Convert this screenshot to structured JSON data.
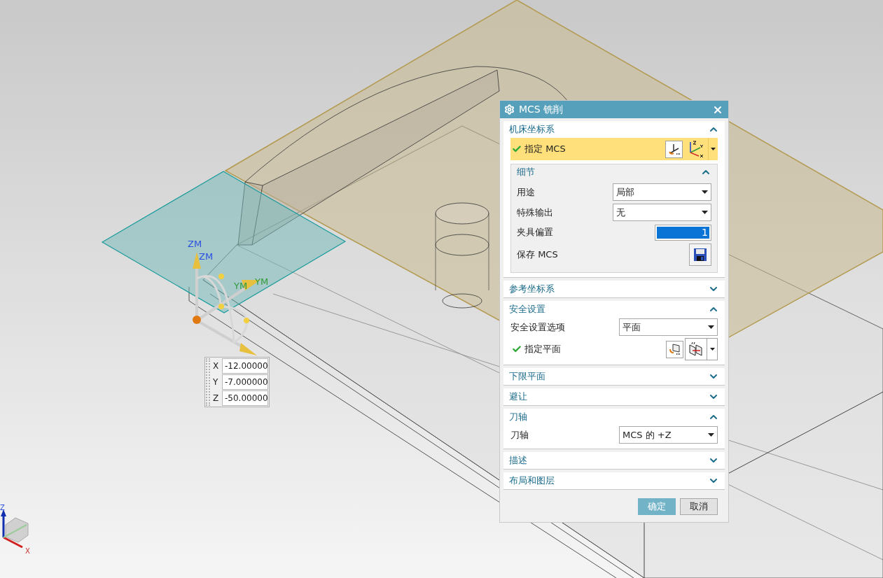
{
  "viewport": {
    "manipulator_labels": [
      "ZM",
      "ZM",
      "YM",
      "YM"
    ],
    "coord_fields": [
      {
        "label": "X",
        "value": "-12.00000"
      },
      {
        "label": "Y",
        "value": "-7.000000"
      },
      {
        "label": "Z",
        "value": "-50.00000"
      }
    ],
    "triad_labels": [
      "Z",
      "X"
    ]
  },
  "dialog": {
    "title": "MCS 铣削",
    "sections": [
      {
        "title": "机床坐标系",
        "expanded": true,
        "rows": [
          {
            "kind": "csys_selector",
            "label": "指定 MCS",
            "done": true,
            "highlighted": true
          },
          {
            "kind": "group",
            "title": "细节",
            "expanded": true,
            "rows": [
              {
                "kind": "dropdown",
                "label": "用途",
                "value": "局部"
              },
              {
                "kind": "dropdown",
                "label": "特殊输出",
                "value": "无"
              },
              {
                "kind": "number",
                "label": "夹具偏置",
                "value": "1",
                "selected": true
              },
              {
                "kind": "save",
                "label": "保存 MCS"
              }
            ]
          }
        ]
      },
      {
        "title": "参考坐标系",
        "expanded": false
      },
      {
        "title": "安全设置",
        "expanded": true,
        "rows": [
          {
            "kind": "dropdown",
            "label": "安全设置选项",
            "value": "平面"
          },
          {
            "kind": "plane_selector",
            "label": "指定平面",
            "done": true,
            "highlighted": false
          }
        ]
      },
      {
        "title": "下限平面",
        "expanded": false
      },
      {
        "title": "避让",
        "expanded": false
      },
      {
        "title": "刀轴",
        "expanded": true,
        "rows": [
          {
            "kind": "dropdown",
            "label": "刀轴",
            "value": "MCS 的 +Z"
          }
        ]
      },
      {
        "title": "描述",
        "expanded": false
      },
      {
        "title": "布局和图层",
        "expanded": false
      }
    ],
    "buttons": [
      {
        "label": "确定",
        "kind": "primary"
      },
      {
        "label": "取消",
        "kind": "secondary"
      }
    ]
  }
}
